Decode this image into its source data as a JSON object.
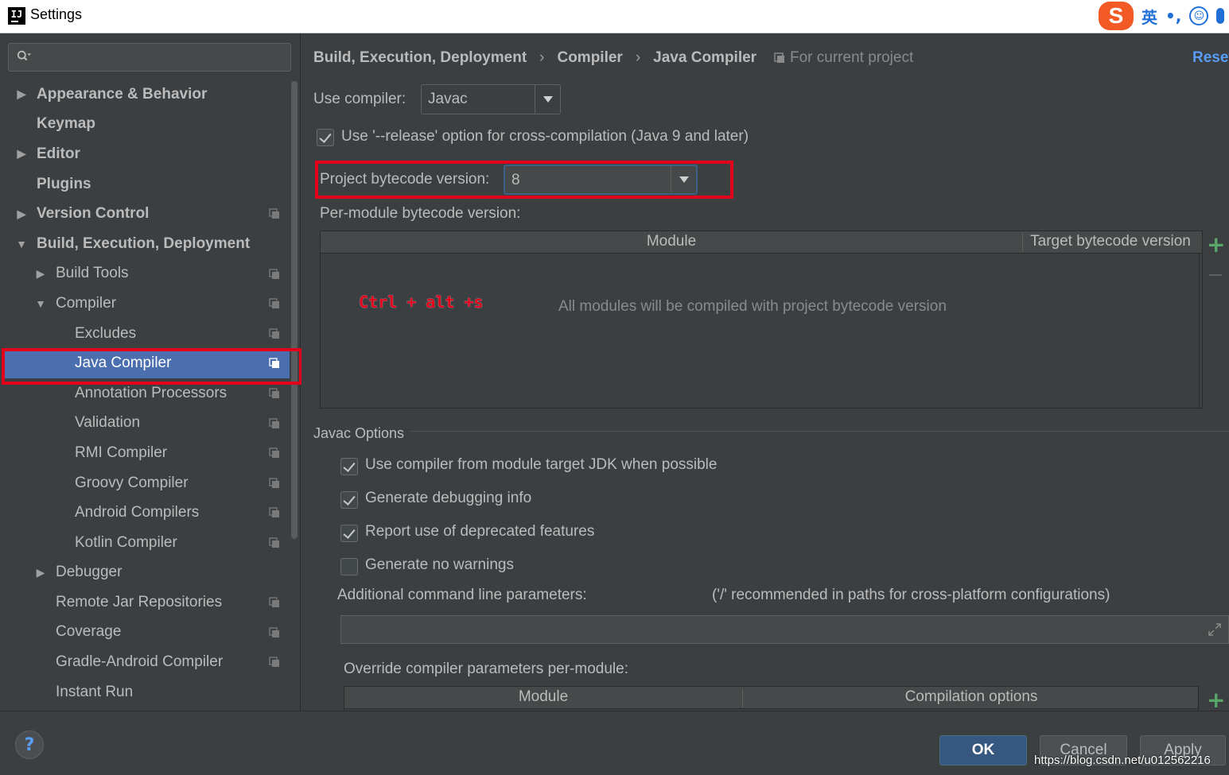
{
  "window": {
    "title": "Settings"
  },
  "ime": {
    "lang": "英",
    "punct": "•,",
    "smile": "☺"
  },
  "search": {
    "placeholder": ""
  },
  "sidebar": {
    "items": [
      {
        "label": "Appearance & Behavior",
        "bold": true,
        "arrow": "right",
        "level": 0,
        "project": false
      },
      {
        "label": "Keymap",
        "bold": true,
        "arrow": "",
        "level": 0,
        "project": false
      },
      {
        "label": "Editor",
        "bold": true,
        "arrow": "right",
        "level": 0,
        "project": false
      },
      {
        "label": "Plugins",
        "bold": true,
        "arrow": "",
        "level": 0,
        "project": false
      },
      {
        "label": "Version Control",
        "bold": true,
        "arrow": "right",
        "level": 0,
        "project": true
      },
      {
        "label": "Build, Execution, Deployment",
        "bold": true,
        "arrow": "down",
        "level": 0,
        "project": false
      },
      {
        "label": "Build Tools",
        "bold": false,
        "arrow": "right",
        "level": 1,
        "project": true
      },
      {
        "label": "Compiler",
        "bold": false,
        "arrow": "down",
        "level": 1,
        "project": true
      },
      {
        "label": "Excludes",
        "bold": false,
        "arrow": "",
        "level": 2,
        "project": true
      },
      {
        "label": "Java Compiler",
        "bold": false,
        "arrow": "",
        "level": 2,
        "project": true,
        "selected": true
      },
      {
        "label": "Annotation Processors",
        "bold": false,
        "arrow": "",
        "level": 2,
        "project": true
      },
      {
        "label": "Validation",
        "bold": false,
        "arrow": "",
        "level": 2,
        "project": true
      },
      {
        "label": "RMI Compiler",
        "bold": false,
        "arrow": "",
        "level": 2,
        "project": true
      },
      {
        "label": "Groovy Compiler",
        "bold": false,
        "arrow": "",
        "level": 2,
        "project": true
      },
      {
        "label": "Android Compilers",
        "bold": false,
        "arrow": "",
        "level": 2,
        "project": true
      },
      {
        "label": "Kotlin Compiler",
        "bold": false,
        "arrow": "",
        "level": 2,
        "project": true
      },
      {
        "label": "Debugger",
        "bold": false,
        "arrow": "right",
        "level": 1,
        "project": false
      },
      {
        "label": "Remote Jar Repositories",
        "bold": false,
        "arrow": "",
        "level": 1,
        "project": true
      },
      {
        "label": "Coverage",
        "bold": false,
        "arrow": "",
        "level": 1,
        "project": true
      },
      {
        "label": "Gradle-Android Compiler",
        "bold": false,
        "arrow": "",
        "level": 1,
        "project": true
      },
      {
        "label": "Instant Run",
        "bold": false,
        "arrow": "",
        "level": 1,
        "project": false
      }
    ]
  },
  "main": {
    "breadcrumb": [
      "Build, Execution, Deployment",
      "Compiler",
      "Java Compiler"
    ],
    "breadcrumb_sep": "›",
    "for_project": "For current project",
    "reset": "Reset",
    "use_compiler_label": "Use compiler:",
    "use_compiler_value": "Javac",
    "release_option": {
      "label": "Use '--release' option for cross-compilation (Java 9 and later)",
      "checked": true
    },
    "bytecode_label": "Project bytecode version:",
    "bytecode_value": "8",
    "per_module_label": "Per-module bytecode version:",
    "module_table": {
      "col_module": "Module",
      "col_target": "Target bytecode version",
      "empty": "All modules will be compiled with project bytecode version"
    },
    "shortcut_note": "Ctrl + alt +s",
    "javac_options_title": "Javac Options",
    "options": [
      {
        "label": "Use compiler from module target JDK when possible",
        "checked": true
      },
      {
        "label": "Generate debugging info",
        "checked": true
      },
      {
        "label": "Report use of deprecated features",
        "checked": true
      },
      {
        "label": "Generate no warnings",
        "checked": false
      }
    ],
    "additional_params_label": "Additional command line parameters:",
    "additional_params_hint": "('/' recommended in paths for cross-platform configurations)",
    "additional_params_value": "",
    "override_label": "Override compiler parameters per-module:",
    "override_table": {
      "col_module": "Module",
      "col_options": "Compilation options"
    }
  },
  "footer": {
    "help": "?",
    "ok": "OK",
    "cancel": "Cancel",
    "apply": "Apply",
    "watermark": "https://blog.csdn.net/u012562216"
  },
  "colors": {
    "accent": "#4b6eaf",
    "highlight": "#e3001b",
    "link": "#589df6",
    "add": "#59a869"
  }
}
